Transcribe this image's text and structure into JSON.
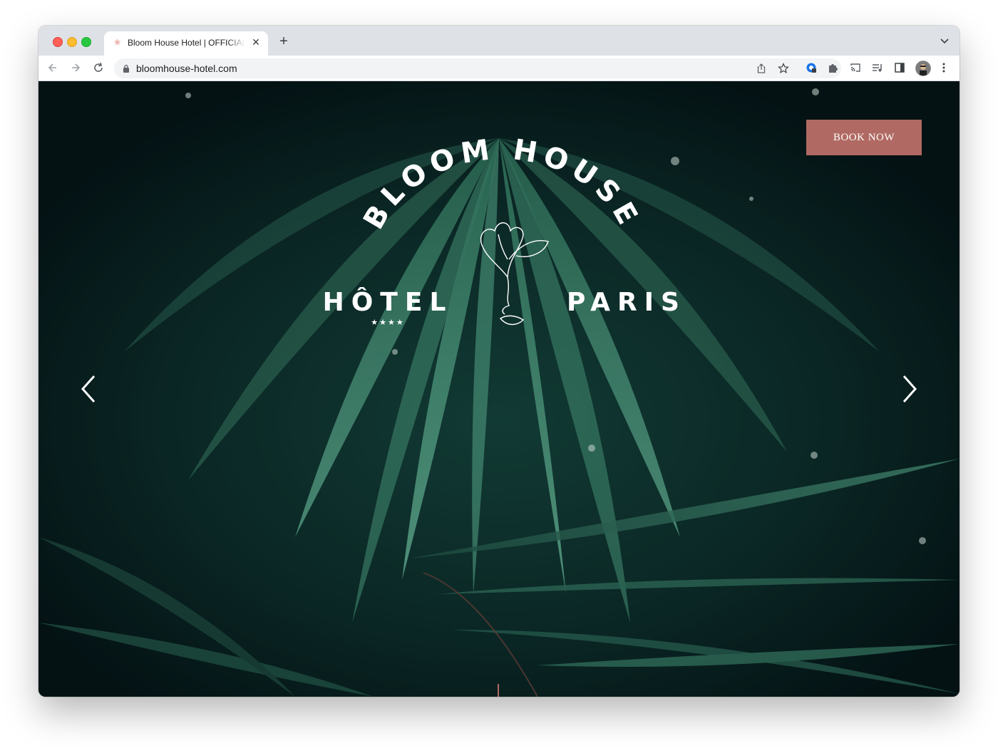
{
  "browser": {
    "tab_title": "Bloom House Hotel | OFFICIAL",
    "url": "bloomhouse-hotel.com"
  },
  "hero": {
    "book_button": "BOOK NOW",
    "logo": {
      "arc_text": "BLOOM HOUSE",
      "left_word": "HÔTEL",
      "right_word": "PARIS",
      "stars": "★★★★"
    }
  },
  "colors": {
    "accent": "#b06a63",
    "page_bg": "#06181a",
    "leaf": "#2f7a5e"
  },
  "icons": [
    "back-icon",
    "forward-icon",
    "reload-icon",
    "lock-icon",
    "share-icon",
    "star-icon",
    "extension-icon",
    "puzzle-icon",
    "cast-icon",
    "media-icon",
    "side-panel-icon",
    "menu-icon",
    "chevron-left-icon",
    "chevron-right-icon"
  ]
}
